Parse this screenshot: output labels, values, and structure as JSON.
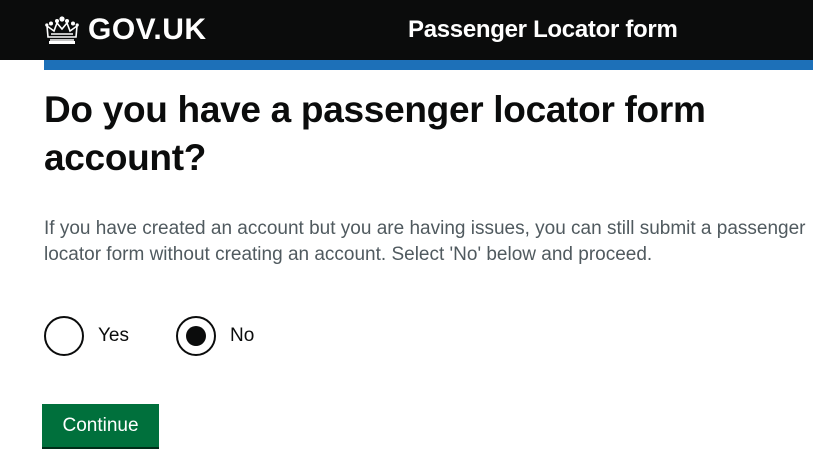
{
  "header": {
    "logo_icon": "crown-icon",
    "logo_text": "GOV.UK",
    "service_name": "Passenger Locator form"
  },
  "main": {
    "heading": "Do you have a passenger locator form account?",
    "hint": "If you have created an account but you are having issues, you can still submit a passenger locator form without creating an account. Select 'No' below and proceed.",
    "options": [
      {
        "label": "Yes",
        "selected": false
      },
      {
        "label": "No",
        "selected": true
      }
    ],
    "continue_label": "Continue"
  },
  "colors": {
    "header_bg": "#0b0c0c",
    "accent_blue": "#1d70b8",
    "button_green": "#00703c",
    "hint_text": "#505a5f"
  }
}
